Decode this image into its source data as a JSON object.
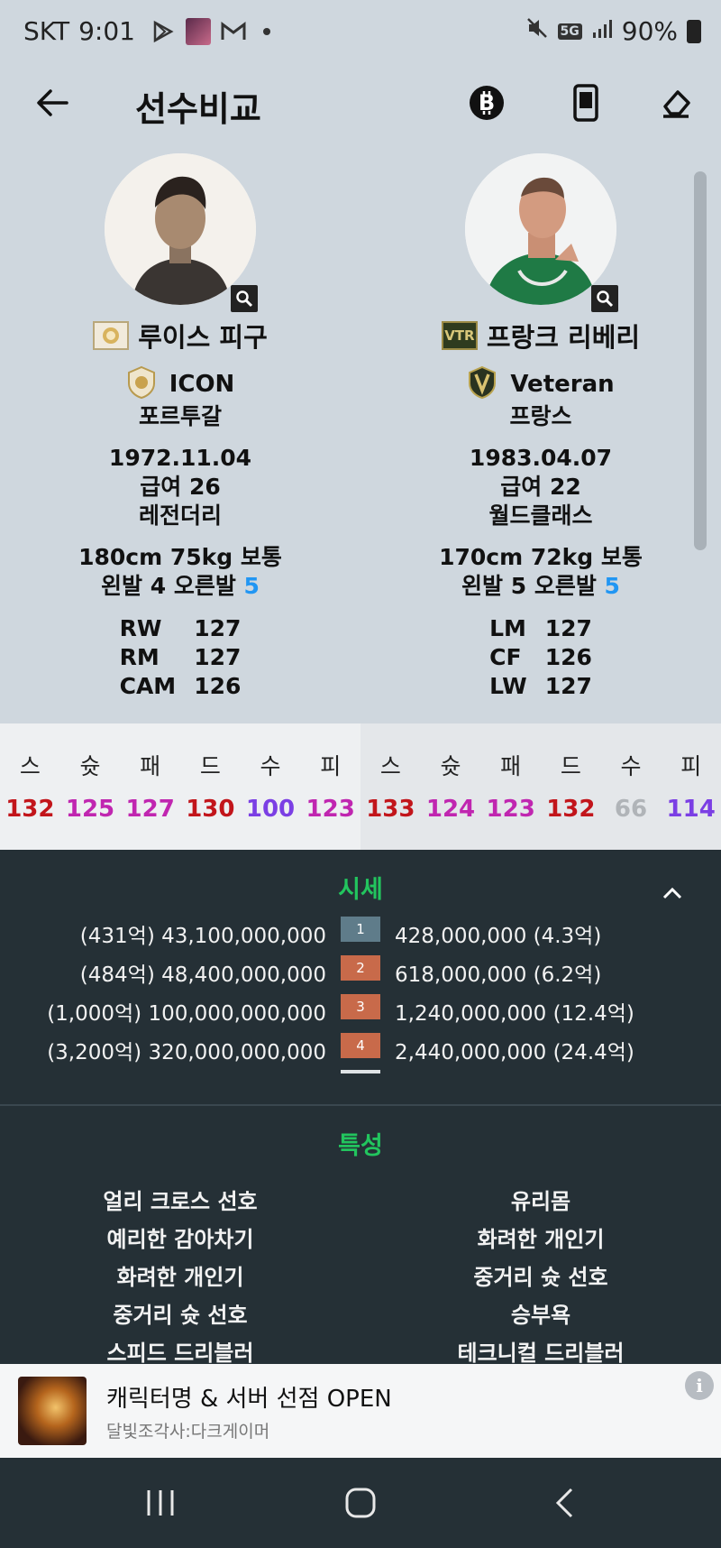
{
  "status_bar": {
    "carrier": "SKT",
    "time": "9:01",
    "network": "5G",
    "battery": "90%"
  },
  "header": {
    "title": "선수비교"
  },
  "players": [
    {
      "name": "루이스 피구",
      "season_badge": "icon-season-badge",
      "class_label": "ICON",
      "nation": "포르투갈",
      "birth": "1972.11.04",
      "salary": "급여 26",
      "reputation": "레전더리",
      "body": "180cm 75kg 보통",
      "foot_text": "왼발 4 오른발 ",
      "foot_strong": "5",
      "positions": [
        {
          "pos": "RW",
          "ovr": "127"
        },
        {
          "pos": "RM",
          "ovr": "127"
        },
        {
          "pos": "CAM",
          "ovr": "126"
        }
      ],
      "stats": [
        {
          "label": "스",
          "value": "132",
          "color": "#c2151b"
        },
        {
          "label": "슛",
          "value": "125",
          "color": "#c026b0"
        },
        {
          "label": "패",
          "value": "127",
          "color": "#c026b0"
        },
        {
          "label": "드",
          "value": "130",
          "color": "#c2151b"
        },
        {
          "label": "수",
          "value": "100",
          "color": "#7b3fe4"
        },
        {
          "label": "피",
          "value": "123",
          "color": "#c026b0"
        }
      ]
    },
    {
      "name": "프랑크 리베리",
      "season_badge": "vtr-season-badge",
      "season_text": "VTR",
      "class_label": "Veteran",
      "nation": "프랑스",
      "birth": "1983.04.07",
      "salary": "급여 22",
      "reputation": "월드클래스",
      "body": "170cm 72kg 보통",
      "foot_text": "왼발 5 오른발 ",
      "foot_strong": "5",
      "positions": [
        {
          "pos": "LM",
          "ovr": "127"
        },
        {
          "pos": "CF",
          "ovr": "126"
        },
        {
          "pos": "LW",
          "ovr": "127"
        }
      ],
      "stats": [
        {
          "label": "스",
          "value": "133",
          "color": "#c2151b"
        },
        {
          "label": "슛",
          "value": "124",
          "color": "#c026b0"
        },
        {
          "label": "패",
          "value": "123",
          "color": "#c026b0"
        },
        {
          "label": "드",
          "value": "132",
          "color": "#c2151b"
        },
        {
          "label": "수",
          "value": "66",
          "color": "#b0b4b8"
        },
        {
          "label": "피",
          "value": "114",
          "color": "#7b3fe4"
        }
      ]
    }
  ],
  "market": {
    "title": "시세",
    "rows": [
      {
        "left": "(431억) 43,100,000,000",
        "grade": "1",
        "grade_color": "#5f7c8a",
        "right": "428,000,000 (4.3억)"
      },
      {
        "left": "(484억) 48,400,000,000",
        "grade": "2",
        "grade_color": "#c86a4a",
        "right": "618,000,000 (6.2억)"
      },
      {
        "left": "(1,000억) 100,000,000,000",
        "grade": "3",
        "grade_color": "#c86a4a",
        "right": "1,240,000,000 (12.4억)"
      },
      {
        "left": "(3,200억) 320,000,000,000",
        "grade": "4",
        "grade_color": "#c86a4a",
        "right": "2,440,000,000 (24.4억)"
      }
    ]
  },
  "traits": {
    "title": "특성",
    "rows": [
      {
        "left": "얼리 크로스 선호",
        "right": "유리몸"
      },
      {
        "left": "예리한 감아차기",
        "right": "화려한 개인기"
      },
      {
        "left": "화려한 개인기",
        "right": "중거리 슛 선호"
      },
      {
        "left": "중거리 슛 선호",
        "right": "승부욕"
      },
      {
        "left": "스피드 드리블러",
        "right": "테크니컬 드리블러"
      }
    ]
  },
  "ad": {
    "title": "캐릭터명 & 서버 선점 OPEN",
    "subtitle": "달빛조각사:다크게이머",
    "info": "i"
  }
}
